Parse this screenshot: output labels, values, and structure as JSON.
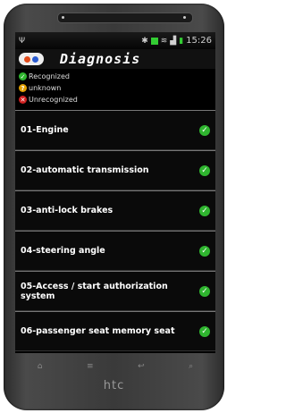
{
  "status": {
    "time": "15:26"
  },
  "app": {
    "title": "Diagnosis"
  },
  "legend": [
    {
      "label": "Recognized",
      "color": "#2fb52f",
      "icon": "check-icon"
    },
    {
      "label": "unknown",
      "color": "#e0a000",
      "icon": "question-icon"
    },
    {
      "label": "Unrecognized",
      "color": "#d02020",
      "icon": "cross-icon"
    }
  ],
  "items": [
    {
      "label": "01-Engine"
    },
    {
      "label": "02-automatic transmission"
    },
    {
      "label": "03-anti-lock brakes"
    },
    {
      "label": "04-steering angle"
    },
    {
      "label": "05-Access / start authorization system"
    },
    {
      "label": "06-passenger seat memory seat"
    }
  ],
  "device": {
    "brand": "htc"
  }
}
